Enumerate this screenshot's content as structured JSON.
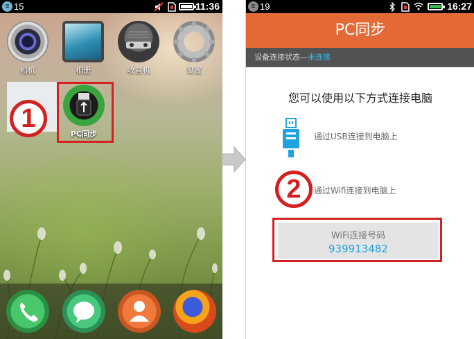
{
  "left_screen": {
    "status": {
      "badge": "≡",
      "notification_count": "15",
      "time": "11:36"
    },
    "apps": [
      {
        "label": "相机",
        "icon": "camera-icon"
      },
      {
        "label": "相册",
        "icon": "gallery-icon"
      },
      {
        "label": "收音机",
        "icon": "radio-icon"
      },
      {
        "label": "设置",
        "icon": "settings-icon"
      },
      {
        "label": "PC同步",
        "icon": "usb-sync-icon"
      }
    ],
    "dock": [
      {
        "icon": "phone-icon"
      },
      {
        "icon": "messages-icon"
      },
      {
        "icon": "contacts-icon"
      },
      {
        "icon": "firefox-icon"
      }
    ],
    "step_marker": "1"
  },
  "right_screen": {
    "status": {
      "badge": "≡",
      "notification_count": "19",
      "time": "16:27"
    },
    "title": "PC同步",
    "connection_status_label": "设备连接状态—",
    "connection_status_value": "未连接",
    "heading": "您可以使用以下方式连接电脑",
    "options": [
      {
        "label": "通过USB连接到电脑上",
        "icon": "usb-icon"
      },
      {
        "label": "通过Wifi连接到电脑上",
        "icon": "wifi-icon"
      }
    ],
    "wifi_code_label": "WiFi连接号码",
    "wifi_code": "939913482",
    "step_marker": "2"
  },
  "colors": {
    "highlight_red": "#d42020",
    "header_orange": "#e36a37",
    "accent_blue": "#1fa3e0",
    "subheader_gray": "#525252"
  }
}
